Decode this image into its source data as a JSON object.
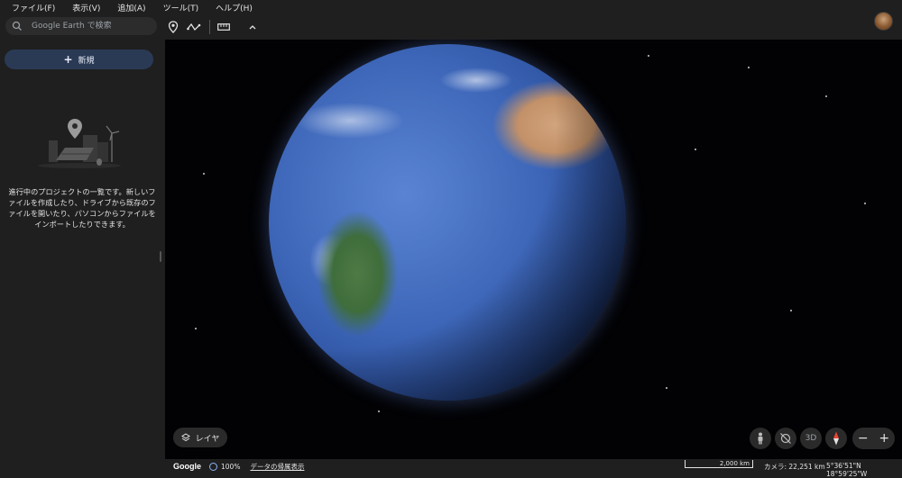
{
  "menu": [
    "ファイル(F)",
    "表示(V)",
    "追加(A)",
    "ツール(T)",
    "ヘルプ(H)"
  ],
  "search": {
    "placeholder": "Google Earth で検索"
  },
  "sidebar": {
    "new_label": "新規",
    "empty_message": "進行中のプロジェクトの一覧です。新しいファイルを作成したり、ドライブから既存のファイルを開いたり、パソコンからファイルをインポートしたりできます。"
  },
  "map_controls": {
    "layers_label": "レイヤ",
    "view_3d_label": "3D",
    "zoom_out": "−",
    "zoom_in": "+"
  },
  "status": {
    "brand": "Google",
    "load_percent": "100%",
    "attribution_link": "データの帰属表示",
    "scale_label": "2,000 km",
    "camera": "カメラ: 22,251 km",
    "coordinates": "5°36'51\"N 18°59'25\"W"
  },
  "colors": {
    "accent": "#8ab4f8",
    "new_button_bg": "#2a3a55",
    "compass_red": "#ea4335"
  }
}
